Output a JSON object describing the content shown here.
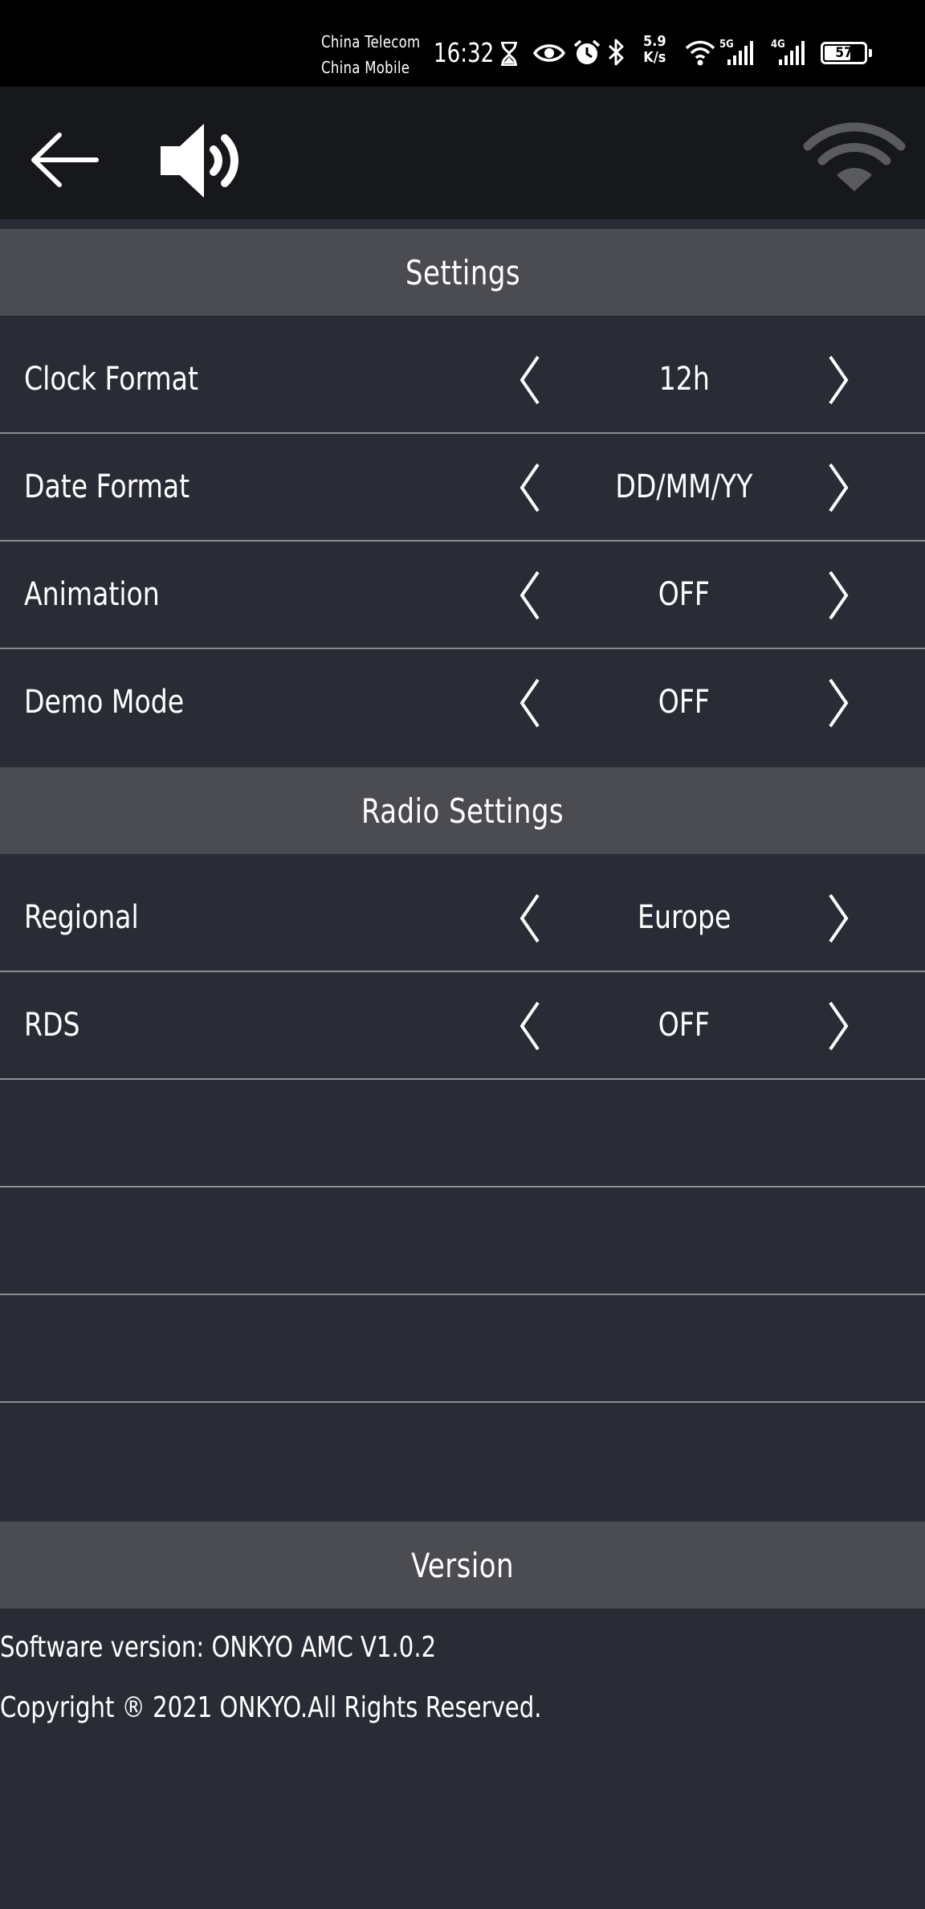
{
  "status_bar": {
    "carrier_1": "China Telecom",
    "carrier_2": "China Mobile",
    "time": "16:32",
    "net_speed_value": "5.9",
    "net_speed_unit": "K/s",
    "signal_1_label": "5G",
    "signal_2_label": "4G",
    "battery": "57",
    "icons": [
      "hourglass-icon",
      "eye-icon",
      "alarm-icon",
      "bluetooth-icon",
      "wifi-icon",
      "cell-signal-icon",
      "cell-signal-icon",
      "battery-icon"
    ]
  },
  "app_bar": {
    "icons": [
      "back-arrow-icon",
      "speaker-volume-icon",
      "wifi-signal-icon"
    ]
  },
  "sections": {
    "settings": {
      "title": "Settings",
      "rows": [
        {
          "label": "Clock Format",
          "value": "12h"
        },
        {
          "label": "Date Format",
          "value": "DD/MM/YY"
        },
        {
          "label": "Animation",
          "value": "OFF"
        },
        {
          "label": "Demo Mode",
          "value": "OFF"
        }
      ]
    },
    "radio": {
      "title": "Radio Settings",
      "rows": [
        {
          "label": "Regional",
          "value": "Europe"
        },
        {
          "label": "RDS",
          "value": "OFF"
        }
      ]
    },
    "version": {
      "title": "Version",
      "software": "Software version: ONKYO AMC V1.0.2",
      "copyright": "Copyright ® 2021 ONKYO.All Rights Reserved."
    }
  },
  "colors": {
    "status_bar_bg": "#000000",
    "app_bar_bg": "#17181c",
    "page_bg": "#2a2c35",
    "section_header_bg": "#4b4c51",
    "divider": "#8b8d93",
    "text": "#ffffff",
    "wifi_inactive": "#5a5b60"
  }
}
